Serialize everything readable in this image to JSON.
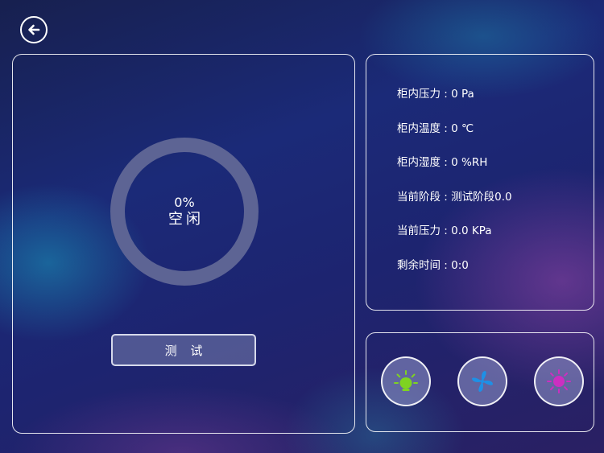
{
  "back": {
    "icon": "back-arrow-icon"
  },
  "status": {
    "percent_text": "0%",
    "percent_value": 0,
    "state": "空闲"
  },
  "test_button": {
    "label": "测 试"
  },
  "info": [
    {
      "label": "柜内压力 : 0 Pa"
    },
    {
      "label": "柜内温度 : 0 ℃"
    },
    {
      "label": "柜内湿度 : 0 %RH"
    },
    {
      "label": "当前阶段 : 测试阶段0.0"
    },
    {
      "label": "当前压力 : 0.0 KPa"
    },
    {
      "label": "剩余时间 : 0:0"
    }
  ],
  "controls": [
    {
      "icon": "light-bulb-icon",
      "color": "#7ed321"
    },
    {
      "icon": "fan-icon",
      "color": "#1e90e6"
    },
    {
      "icon": "uv-lamp-icon",
      "color": "#cc2fc1"
    }
  ],
  "colors": {
    "ring_track": "#5d6494",
    "ring_progress": "#ffffff"
  }
}
